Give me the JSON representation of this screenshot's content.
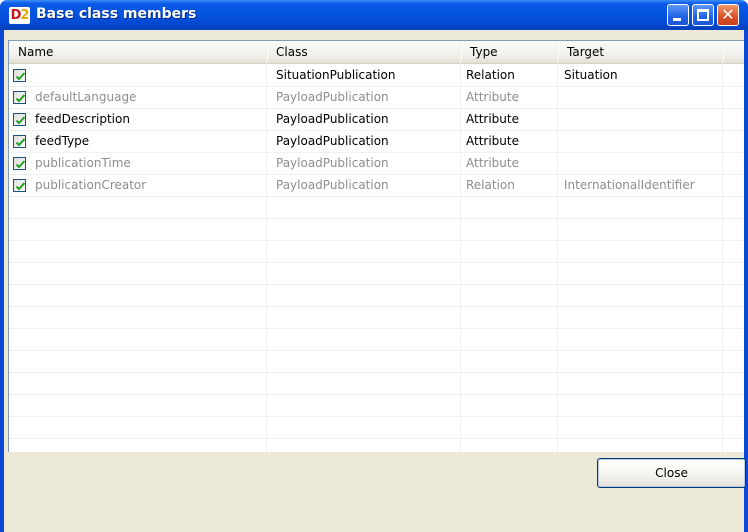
{
  "window": {
    "title": "Base class members",
    "logo_text_a": "D",
    "logo_text_b": "2"
  },
  "table": {
    "headers": [
      "Name",
      "Class",
      "Type",
      "Target"
    ],
    "rows": [
      {
        "checked": true,
        "dim": false,
        "name": "",
        "class": "SituationPublication",
        "type": "Relation",
        "target": "Situation"
      },
      {
        "checked": true,
        "dim": true,
        "name": "defaultLanguage",
        "class": "PayloadPublication",
        "type": "Attribute",
        "target": ""
      },
      {
        "checked": true,
        "dim": false,
        "name": "feedDescription",
        "class": "PayloadPublication",
        "type": "Attribute",
        "target": ""
      },
      {
        "checked": true,
        "dim": false,
        "name": "feedType",
        "class": "PayloadPublication",
        "type": "Attribute",
        "target": ""
      },
      {
        "checked": true,
        "dim": true,
        "name": "publicationTime",
        "class": "PayloadPublication",
        "type": "Attribute",
        "target": ""
      },
      {
        "checked": true,
        "dim": true,
        "name": "publicationCreator",
        "class": "PayloadPublication",
        "type": "Relation",
        "target": "InternationalIdentifier"
      }
    ]
  },
  "buttons": {
    "close_label": "Close"
  }
}
